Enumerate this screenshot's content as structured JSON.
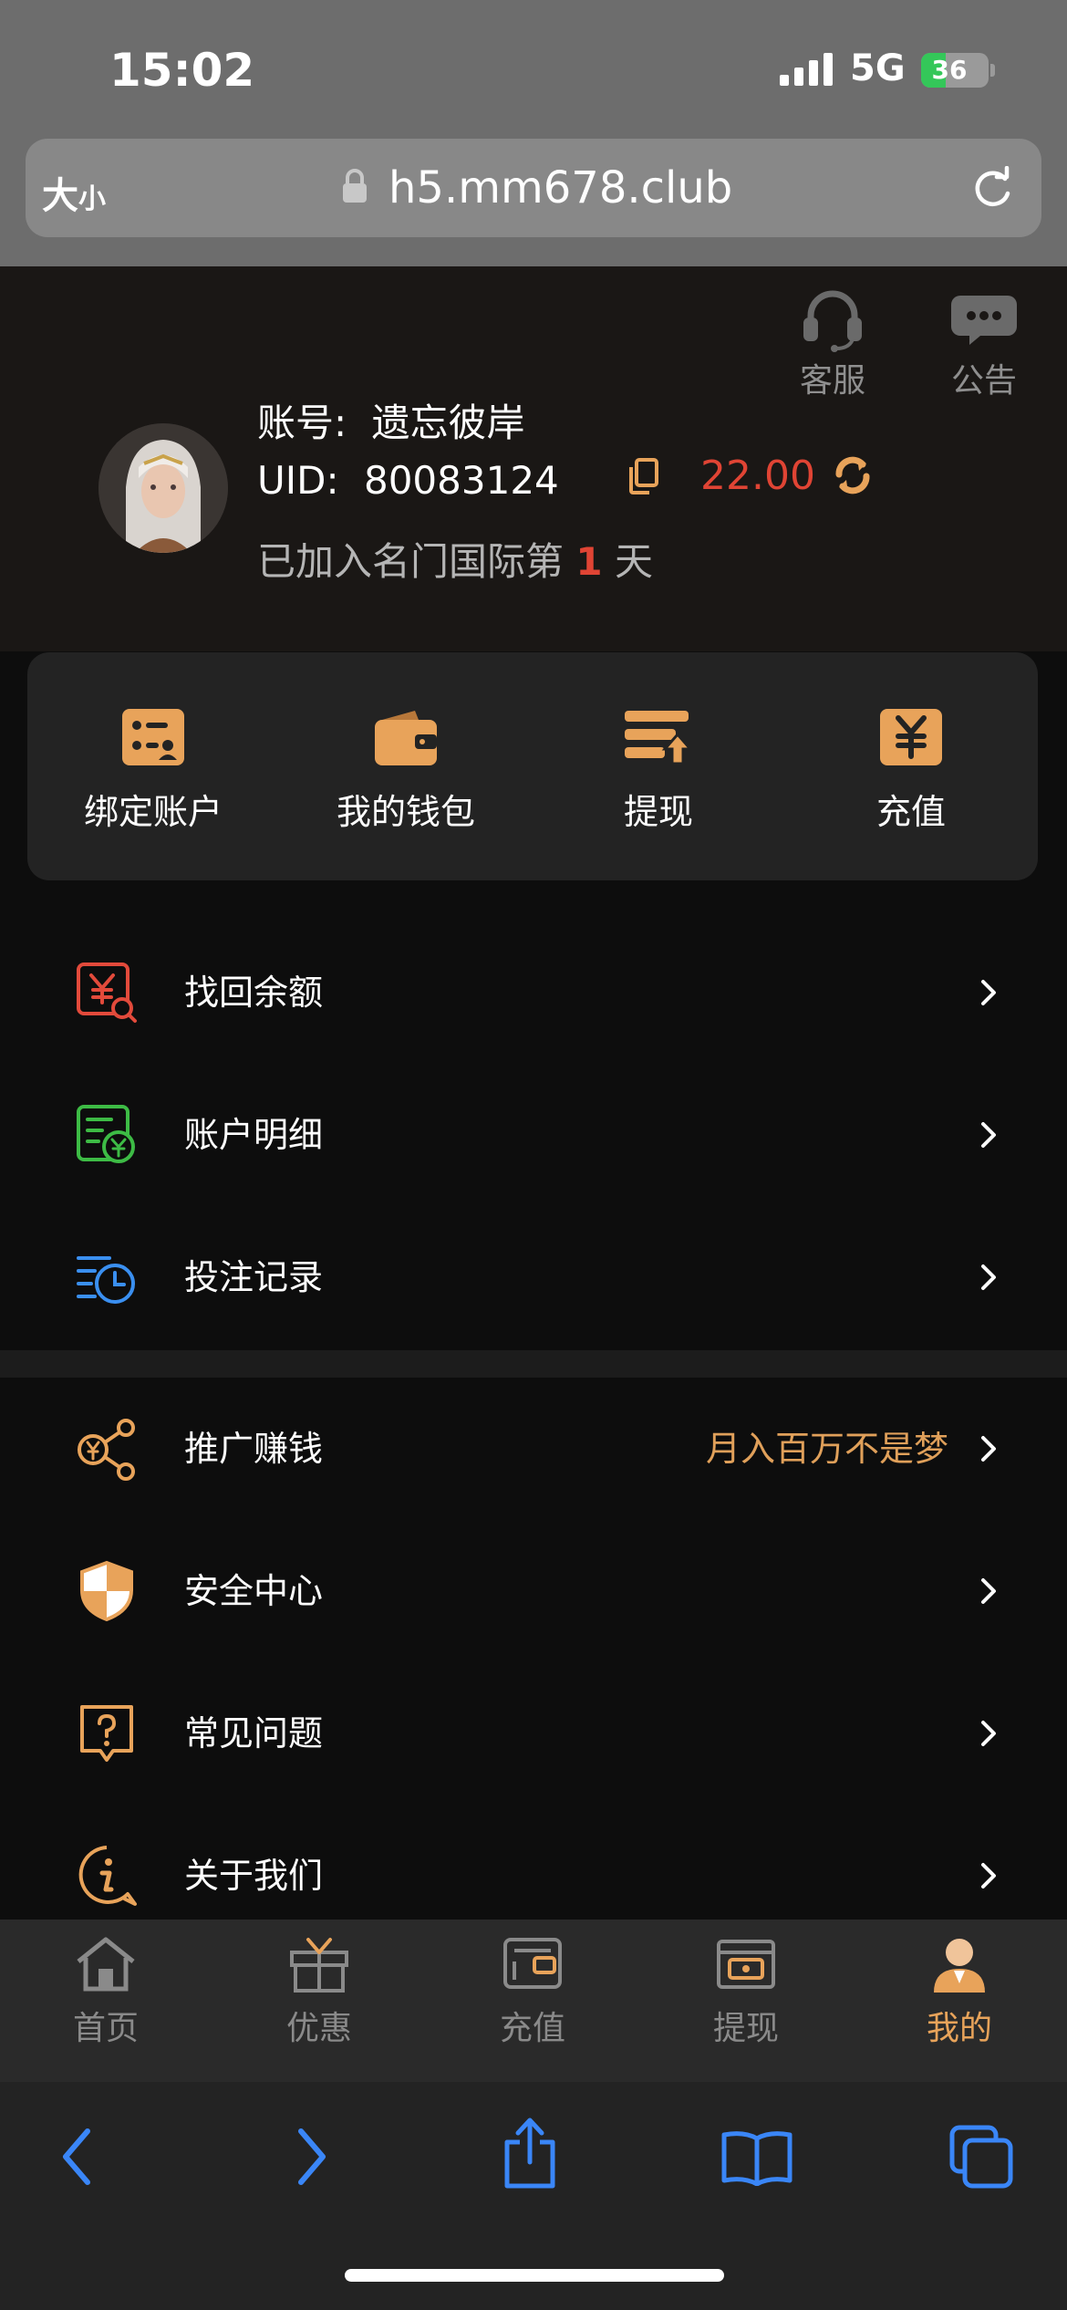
{
  "status_bar": {
    "time": "15:02",
    "network": "5G",
    "battery": "36",
    "battery_level": 0.36
  },
  "browser": {
    "text_size_big": "大",
    "text_size_small": "小",
    "url": "h5.mm678.club"
  },
  "header": {
    "service_label": "客服",
    "notice_label": "公告",
    "account_label": "账号:",
    "account_name": "遗忘彼岸",
    "uid_label": "UID:",
    "uid_value": "80083124",
    "balance": "22.00",
    "days_prefix": "已加入名门国际第",
    "days_value": "1",
    "days_suffix": "天"
  },
  "quick_actions": [
    {
      "label": "绑定账户",
      "icon": "bind-account-icon"
    },
    {
      "label": "我的钱包",
      "icon": "wallet-icon"
    },
    {
      "label": "提现",
      "icon": "withdraw-icon"
    },
    {
      "label": "充值",
      "icon": "recharge-icon"
    }
  ],
  "menu_group_1": [
    {
      "label": "找回余额",
      "icon": "recover-balance-icon",
      "color": "#e24a3b"
    },
    {
      "label": "账户明细",
      "icon": "account-detail-icon",
      "color": "#3dbb45"
    },
    {
      "label": "投注记录",
      "icon": "bet-record-icon",
      "color": "#3a8ff0"
    }
  ],
  "menu_group_2": [
    {
      "label": "推广赚钱",
      "extra": "月入百万不是梦",
      "icon": "share-earn-icon"
    },
    {
      "label": "安全中心",
      "icon": "shield-icon"
    },
    {
      "label": "常见问题",
      "icon": "question-icon"
    },
    {
      "label": "关于我们",
      "icon": "info-icon"
    }
  ],
  "tabs": [
    {
      "label": "首页",
      "icon": "home-icon"
    },
    {
      "label": "优惠",
      "icon": "gift-icon"
    },
    {
      "label": "充值",
      "icon": "recharge-tab-icon"
    },
    {
      "label": "提现",
      "icon": "withdraw-tab-icon"
    },
    {
      "label": "我的",
      "icon": "profile-icon",
      "active": true
    }
  ],
  "colors": {
    "accent": "#e8a35a",
    "balance": "#e04434",
    "safari_blue": "#3a86f7"
  }
}
